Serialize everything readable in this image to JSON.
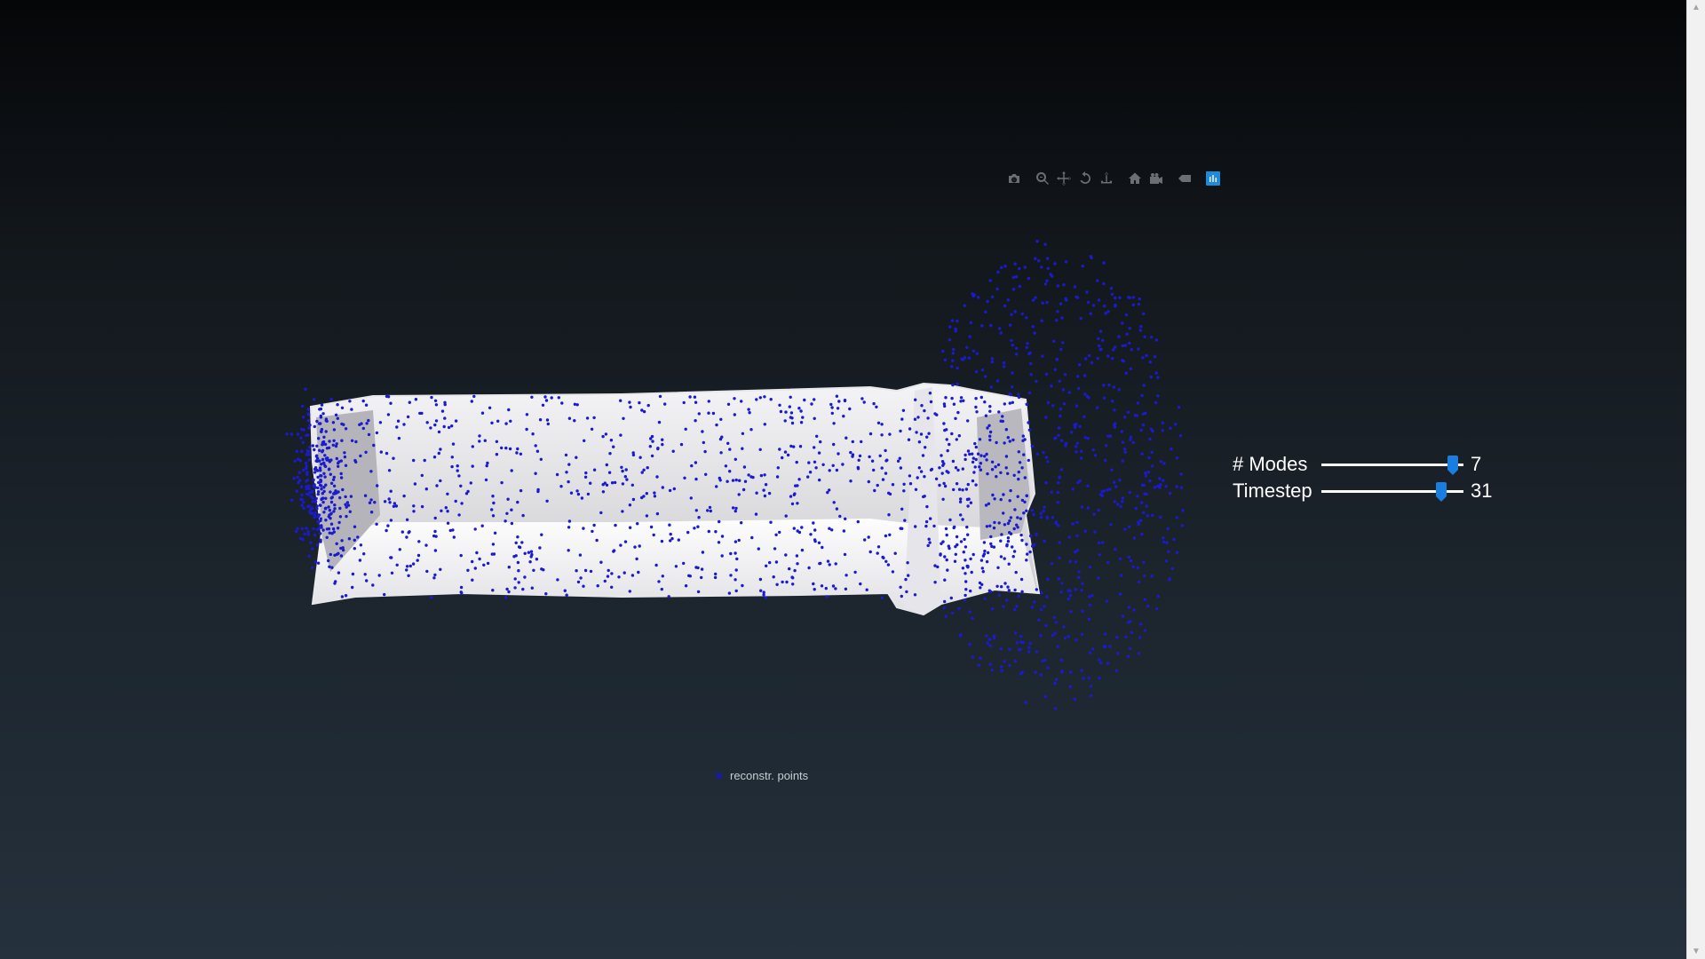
{
  "modebar": {
    "buttons": [
      {
        "icon": "camera-icon",
        "title": "Download plot as a png"
      },
      {
        "icon": "zoom-icon",
        "title": "Zoom"
      },
      {
        "icon": "pan-icon",
        "title": "Pan"
      },
      {
        "icon": "orbit-rotation-icon",
        "title": "Orbital rotation"
      },
      {
        "icon": "turntable-rotation-icon",
        "title": "Turntable rotation"
      },
      {
        "icon": "home-icon",
        "title": "Reset camera to default"
      },
      {
        "icon": "camera-view-icon",
        "title": "Reset camera to last save"
      },
      {
        "icon": "hover-tag-icon",
        "title": "Toggle show closest data on hover"
      },
      {
        "icon": "plotly-logo-icon",
        "title": "Produced with Plotly"
      }
    ]
  },
  "sliders": {
    "modes": {
      "label": "# Modes",
      "value": "7",
      "fraction": 0.96
    },
    "timestep": {
      "label": "Timestep",
      "value": "31",
      "fraction": 0.87
    }
  },
  "legend": {
    "label": "reconstr. points",
    "color": "#1a1aa8"
  },
  "colors": {
    "background_top": "#050608",
    "background_bottom": "#25313d",
    "mesh": "#d8d8dc",
    "points": "#1a1ad0",
    "slider_thumb": "#1a7ee0"
  }
}
